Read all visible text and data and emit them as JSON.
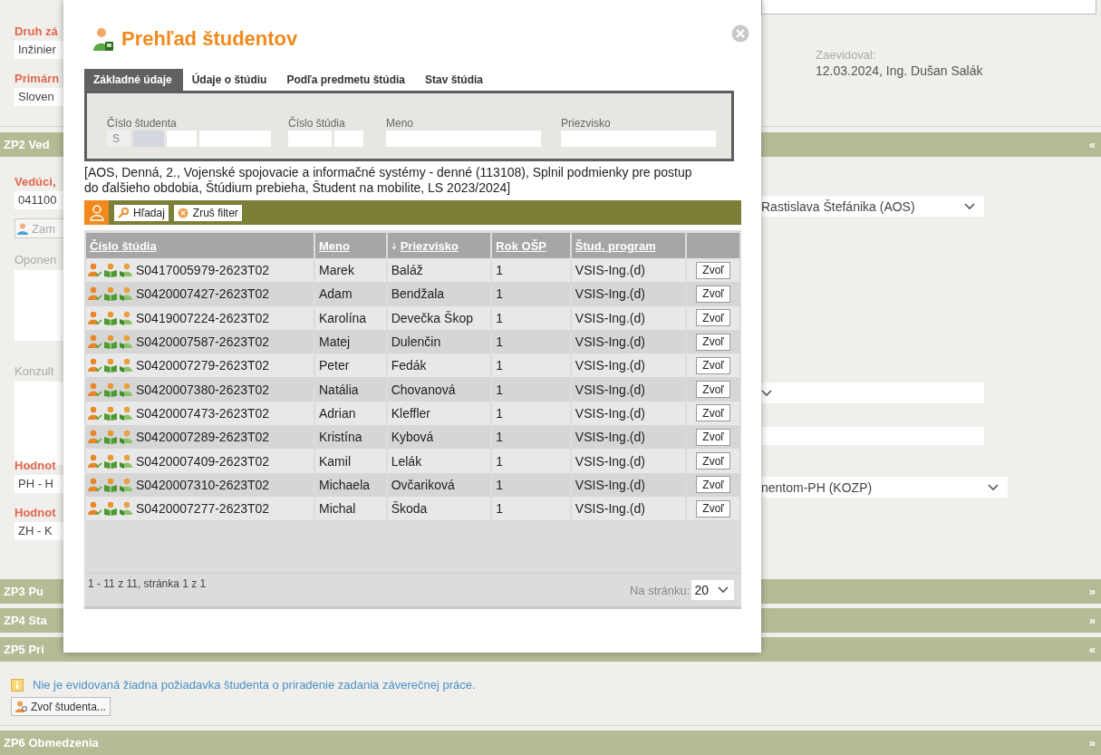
{
  "page": {
    "degree": {
      "label": "Druh zá",
      "value": "Inžinier"
    },
    "primary": {
      "label": "Primárn",
      "value": "Sloven"
    },
    "recorded": {
      "label": "Zaevidoval:",
      "value": "12.03.2024, Ing. Dušan Salák"
    },
    "section_zp2": {
      "title": "ZP2 Ved",
      "toggle": "«"
    },
    "supervisor": {
      "label": "Vedúci,",
      "value": "041100",
      "department": "Rastislava Štefánika (AOS)"
    },
    "assign_button": "Zam",
    "opponent": {
      "label": "Oponen"
    },
    "consultant": {
      "label": "Konzult"
    },
    "evaluation_1": {
      "label": "Hodnot",
      "value": "PH - H",
      "select_value": "nentom-PH (KOZP)"
    },
    "evaluation_2": {
      "label": "Hodnot",
      "value": "ZH - K"
    },
    "collapsed_sections": [
      {
        "title": "ZP3 Pu",
        "toggle": "»"
      },
      {
        "title": "ZP4 Sta",
        "toggle": "»"
      },
      {
        "title": "ZP5 Pri",
        "toggle": "«"
      }
    ],
    "notice": "Nie je evidovaná žiadna požiadavka študenta o priradenie zadania záverečnej práce.",
    "choose_student_button": "Zvoľ študenta...",
    "section_zp6": {
      "title": "ZP6 Obmedzenia",
      "toggle": "»"
    }
  },
  "dialog": {
    "title": "Prehľad študentov",
    "tabs": [
      {
        "label": "Základné údaje",
        "selected": true
      },
      {
        "label": "Údaje o štúdiu",
        "selected": false
      },
      {
        "label": "Podľa predmetu štúdia",
        "selected": false
      },
      {
        "label": "Stav štúdia",
        "selected": false
      }
    ],
    "filter": {
      "student_number": {
        "label": "Číslo študenta",
        "prefix": "S"
      },
      "study_number": {
        "label": "Číslo štúdia"
      },
      "first_name": {
        "label": "Meno"
      },
      "last_name": {
        "label": "Priezvisko"
      }
    },
    "summary": "[AOS, Denná, 2., Vojenské spojovacie a informačné systémy - denné (113108), Splnil podmienky pre postup do ďalšieho obdobia, Štúdium prebieha, Študent na mobilite, LS 2023/2024]",
    "toolbar": {
      "search": "Hľadaj",
      "clear": "Zruš filter"
    },
    "table": {
      "columns": [
        {
          "label": "Číslo štúdia",
          "sorted": false
        },
        {
          "label": "Meno",
          "sorted": false
        },
        {
          "label": "Priezvisko",
          "sorted": true
        },
        {
          "label": "Rok OŠP",
          "sorted": false
        },
        {
          "label": "Štud. program",
          "sorted": false
        }
      ],
      "rows": [
        {
          "id": "S0417005979-2623T02",
          "first": "Marek",
          "last": "Baláž",
          "year": "1",
          "program": "VSIS-Ing.(d)",
          "action": "Zvoľ"
        },
        {
          "id": "S0420007427-2623T02",
          "first": "Adam",
          "last": "Bendžala",
          "year": "1",
          "program": "VSIS-Ing.(d)",
          "action": "Zvoľ"
        },
        {
          "id": "S0419007224-2623T02",
          "first": "Karolína",
          "last": "Devečka Škop",
          "year": "1",
          "program": "VSIS-Ing.(d)",
          "action": "Zvoľ"
        },
        {
          "id": "S0420007587-2623T02",
          "first": "Matej",
          "last": "Dulenčin",
          "year": "1",
          "program": "VSIS-Ing.(d)",
          "action": "Zvoľ"
        },
        {
          "id": "S0420007279-2623T02",
          "first": "Peter",
          "last": "Fedák",
          "year": "1",
          "program": "VSIS-Ing.(d)",
          "action": "Zvoľ"
        },
        {
          "id": "S0420007380-2623T02",
          "first": "Natália",
          "last": "Chovanová",
          "year": "1",
          "program": "VSIS-Ing.(d)",
          "action": "Zvoľ"
        },
        {
          "id": "S0420007473-2623T02",
          "first": "Adrian",
          "last": "Kleffler",
          "year": "1",
          "program": "VSIS-Ing.(d)",
          "action": "Zvoľ"
        },
        {
          "id": "S0420007289-2623T02",
          "first": "Kristína",
          "last": "Kybová",
          "year": "1",
          "program": "VSIS-Ing.(d)",
          "action": "Zvoľ"
        },
        {
          "id": "S0420007409-2623T02",
          "first": "Kamil",
          "last": "Lelák",
          "year": "1",
          "program": "VSIS-Ing.(d)",
          "action": "Zvoľ"
        },
        {
          "id": "S0420007310-2623T02",
          "first": "Michaela",
          "last": "Ovčariková",
          "year": "1",
          "program": "VSIS-Ing.(d)",
          "action": "Zvoľ"
        },
        {
          "id": "S0420007277-2623T02",
          "first": "Michal",
          "last": "Škoda",
          "year": "1",
          "program": "VSIS-Ing.(d)",
          "action": "Zvoľ"
        }
      ]
    },
    "footer": {
      "range": "1 - 11 z 11, stránka 1 z 1",
      "page_size_label": "Na stránku:",
      "page_size": "20"
    }
  }
}
